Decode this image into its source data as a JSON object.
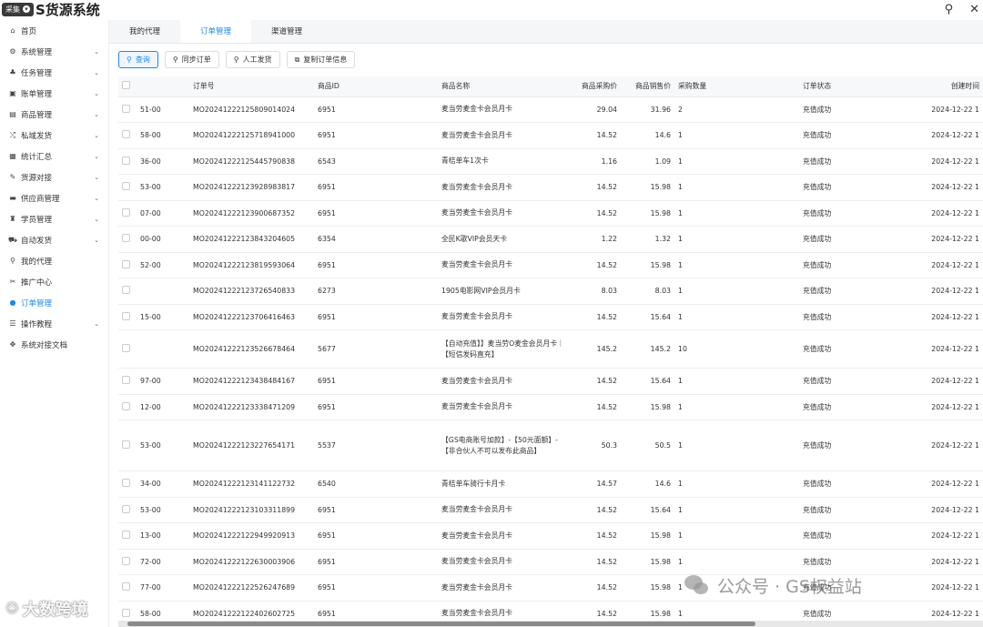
{
  "app": {
    "badge_label": "采集",
    "title": "S货源系统"
  },
  "sidebar": {
    "items": [
      {
        "label": "首页",
        "icon": "home-icon",
        "glyph": "⌂",
        "chev": ""
      },
      {
        "label": "系统管理",
        "icon": "gear-icon",
        "glyph": "⚙",
        "chev": "⌄"
      },
      {
        "label": "任务管理",
        "icon": "users-icon",
        "glyph": "♣",
        "chev": "⌄"
      },
      {
        "label": "账单管理",
        "icon": "bill-icon",
        "glyph": "▣",
        "chev": "⌄"
      },
      {
        "label": "商品管理",
        "icon": "box-icon",
        "glyph": "▤",
        "chev": "⌄"
      },
      {
        "label": "私域发货",
        "icon": "shuffle-icon",
        "glyph": "⤮",
        "chev": "⌄"
      },
      {
        "label": "统计汇总",
        "icon": "table-icon",
        "glyph": "▦",
        "chev": "⌄"
      },
      {
        "label": "货源对接",
        "icon": "plug-icon",
        "glyph": "✎",
        "chev": "⌄"
      },
      {
        "label": "供应商管理",
        "icon": "list-icon",
        "glyph": "▬",
        "chev": "⌄"
      },
      {
        "label": "学员管理",
        "icon": "student-icon",
        "glyph": "♜",
        "chev": "⌄"
      },
      {
        "label": "自动发货",
        "icon": "car-icon",
        "glyph": "⛟",
        "chev": "⌄"
      },
      {
        "label": "我的代理",
        "icon": "link-icon",
        "glyph": "⚲",
        "chev": ""
      },
      {
        "label": "推广中心",
        "icon": "promote-icon",
        "glyph": "✂",
        "chev": ""
      },
      {
        "label": "订单管理",
        "icon": "order-icon",
        "glyph": "●",
        "chev": "",
        "active": true
      },
      {
        "label": "操作教程",
        "icon": "tutorial-icon",
        "glyph": "☰",
        "chev": "⌄"
      },
      {
        "label": "系统对接文档",
        "icon": "doc-icon",
        "glyph": "✥",
        "chev": ""
      }
    ]
  },
  "tabs": [
    "我的代理",
    "订单管理",
    "渠道管理"
  ],
  "toolbar": {
    "query": "查询",
    "sync": "同步订单",
    "manual": "人工发货",
    "copy": "复制订单信息"
  },
  "table": {
    "headers": {
      "order_no": "订单号",
      "product_id": "商品ID",
      "product_name": "商品名称",
      "purchase_price": "商品采购价",
      "sale_price": "商品销售价",
      "qty": "采购数量",
      "status": "订单状态",
      "created": "创建时间"
    },
    "rows": [
      {
        "c0": "51-00",
        "order": "MO20241222125809014024",
        "pid": "6951",
        "name": "麦当劳麦金卡会员月卡",
        "pp": "29.04",
        "sp": "31.96",
        "qty": "2",
        "status": "充值成功",
        "time": "2024-12-22 1",
        "h": 1
      },
      {
        "c0": "58-00",
        "order": "MO20241222125718941000",
        "pid": "6951",
        "name": "麦当劳麦金卡会员月卡",
        "pp": "14.52",
        "sp": "14.6",
        "qty": "1",
        "status": "充值成功",
        "time": "2024-12-22 1",
        "h": 1
      },
      {
        "c0": "36-00",
        "order": "MO20241222125445790838",
        "pid": "6543",
        "name": "青桔单车1次卡",
        "pp": "1.16",
        "sp": "1.09",
        "qty": "1",
        "status": "充值成功",
        "time": "2024-12-22 1",
        "h": 1
      },
      {
        "c0": "53-00",
        "order": "MO20241222123928983817",
        "pid": "6951",
        "name": "麦当劳麦金卡会员月卡",
        "pp": "14.52",
        "sp": "15.98",
        "qty": "1",
        "status": "充值成功",
        "time": "2024-12-22 1",
        "h": 1
      },
      {
        "c0": "07-00",
        "order": "MO20241222123900687352",
        "pid": "6951",
        "name": "麦当劳麦金卡会员月卡",
        "pp": "14.52",
        "sp": "15.98",
        "qty": "1",
        "status": "充值成功",
        "time": "2024-12-22 1",
        "h": 1
      },
      {
        "c0": "00-00",
        "order": "MO20241222123843204605",
        "pid": "6354",
        "name": "全民K歌VIP会员天卡",
        "pp": "1.22",
        "sp": "1.32",
        "qty": "1",
        "status": "充值成功",
        "time": "2024-12-22 1",
        "h": 1
      },
      {
        "c0": "52-00",
        "order": "MO20241222123819593064",
        "pid": "6951",
        "name": "麦当劳麦金卡会员月卡",
        "pp": "14.52",
        "sp": "15.98",
        "qty": "1",
        "status": "充值成功",
        "time": "2024-12-22 1",
        "h": 1
      },
      {
        "c0": "",
        "order": "MO20241222123726540833",
        "pid": "6273",
        "name": "1905电影网VIP会员月卡",
        "pp": "8.03",
        "sp": "8.03",
        "qty": "1",
        "status": "充值成功",
        "time": "2024-12-22 1",
        "h": 1
      },
      {
        "c0": "15-00",
        "order": "MO20241222123706416463",
        "pid": "6951",
        "name": "麦当劳麦金卡会员月卡",
        "pp": "14.52",
        "sp": "15.64",
        "qty": "1",
        "status": "充值成功",
        "time": "2024-12-22 1",
        "h": 1
      },
      {
        "c0": "",
        "order": "MO20241222123526678464",
        "pid": "5677",
        "name": "【自动充值】】麦当劳O麦金会员月卡｜【短信发码直充】",
        "pp": "145.2",
        "sp": "145.2",
        "qty": "10",
        "status": "充值成功",
        "time": "2024-12-22 1",
        "h": 2
      },
      {
        "c0": "97-00",
        "order": "MO20241222123438484167",
        "pid": "6951",
        "name": "麦当劳麦金卡会员月卡",
        "pp": "14.52",
        "sp": "15.64",
        "qty": "1",
        "status": "充值成功",
        "time": "2024-12-22 1",
        "h": 1
      },
      {
        "c0": "12-00",
        "order": "MO20241222123338471209",
        "pid": "6951",
        "name": "麦当劳麦金卡会员月卡",
        "pp": "14.52",
        "sp": "15.98",
        "qty": "1",
        "status": "充值成功",
        "time": "2024-12-22 1",
        "h": 1
      },
      {
        "c0": "53-00",
        "order": "MO20241222123227654171",
        "pid": "5537",
        "name": "【GS电商账号加款】-【50元面额】-【非合伙人不可以发布此商品】",
        "pp": "50.3",
        "sp": "50.5",
        "qty": "1",
        "status": "充值成功",
        "time": "2024-12-22 1",
        "h": 3
      },
      {
        "c0": "34-00",
        "order": "MO20241222123141122732",
        "pid": "6540",
        "name": "青桔单车骑行卡月卡",
        "pp": "14.57",
        "sp": "14.6",
        "qty": "1",
        "status": "充值成功",
        "time": "2024-12-22 1",
        "h": 1
      },
      {
        "c0": "53-00",
        "order": "MO20241222123103311899",
        "pid": "6951",
        "name": "麦当劳麦金卡会员月卡",
        "pp": "14.52",
        "sp": "15.64",
        "qty": "1",
        "status": "充值成功",
        "time": "2024-12-22 1",
        "h": 1
      },
      {
        "c0": "13-00",
        "order": "MO20241222122949920913",
        "pid": "6951",
        "name": "麦当劳麦金卡会员月卡",
        "pp": "14.52",
        "sp": "15.98",
        "qty": "1",
        "status": "充值成功",
        "time": "2024-12-22 1",
        "h": 1
      },
      {
        "c0": "72-00",
        "order": "MO20241222122630003906",
        "pid": "6951",
        "name": "麦当劳麦金卡会员月卡",
        "pp": "14.52",
        "sp": "15.98",
        "qty": "1",
        "status": "充值成功",
        "time": "2024-12-22 1",
        "h": 1
      },
      {
        "c0": "77-00",
        "order": "MO20241222122526247689",
        "pid": "6951",
        "name": "麦当劳麦金卡会员月卡",
        "pp": "14.52",
        "sp": "15.98",
        "qty": "1",
        "status": "充值成功",
        "time": "2024-12-22 1",
        "h": 1
      },
      {
        "c0": "58-00",
        "order": "MO20241222122402602725",
        "pid": "6951",
        "name": "麦当劳麦金卡会员月卡",
        "pp": "14.52",
        "sp": "15.98",
        "qty": "1",
        "status": "充值成功",
        "time": "2024-12-22 1",
        "h": 1
      }
    ]
  },
  "watermarks": {
    "right": "公众号 · GS权益站",
    "left": "大数跨境"
  },
  "colors": {
    "accent": "#1e88e5",
    "badge": "#3a3a3a"
  }
}
